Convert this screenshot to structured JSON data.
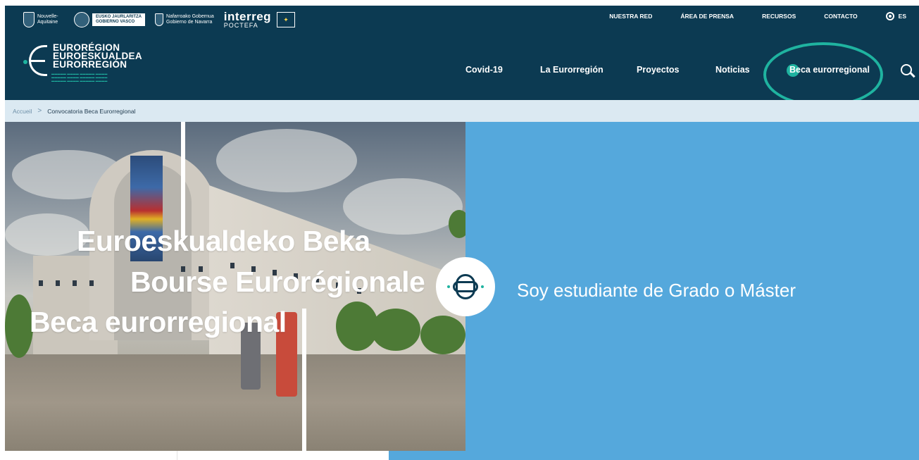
{
  "partners": {
    "region1": "Nouvelle-Aquitaine",
    "region2_line1": "EUSKO JAURLARITZA",
    "region2_line2": "GOBIERNO VASCO",
    "region3_line1": "Nafarroako Gobernua",
    "region3_line2": "Gobierno de Navarra",
    "program": "interreg",
    "program_sub": "POCTEFA"
  },
  "topnav": {
    "items": [
      "NUESTRA RED",
      "ÁREA DE PRENSA",
      "RECURSOS",
      "CONTACTO"
    ],
    "lang": "ES"
  },
  "logo": {
    "line1": "EURORÉGION",
    "line2": "EUROESKUALDEA",
    "line3": "EURORREGIÓN"
  },
  "mainnav": {
    "items": [
      "Covid-19",
      "La Eurorregión",
      "Proyectos",
      "Noticias",
      "Beca eurorregional"
    ],
    "active": "Beca eurorregional"
  },
  "breadcrumb": {
    "home": "Accueil",
    "separator": ">",
    "current": "Convocatoria Beca Eurorregional"
  },
  "hero": {
    "title_line1": "Euroeskualdeko Beka",
    "title_line2": "Bourse Eurorégionale",
    "title_line3": "Beca eurorregional"
  },
  "panel": {
    "text": "Soy estudiante de Grado o Máster"
  },
  "colors": {
    "header_bg": "#0c3a52",
    "accent": "#1fb3a0",
    "panel_blue": "#55a8dc",
    "breadcrumb_bg": "#dbe9f2"
  },
  "icons": {
    "search": "search-icon",
    "globe": "globe-icon",
    "badge": "euroregion-symbol-icon"
  }
}
